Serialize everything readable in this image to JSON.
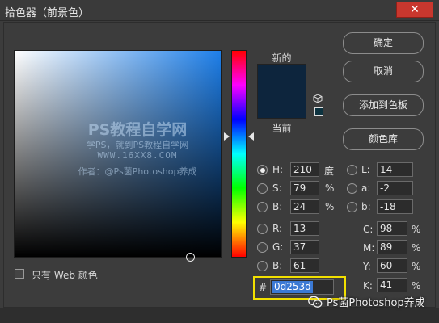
{
  "window": {
    "title": "拾色器（前景色）",
    "close_glyph": "✕"
  },
  "watermark": {
    "line1": "PS教程自学网",
    "line2": "学PS，就到PS教程自学网",
    "line3": "WWW.16XX8.COM",
    "line4": "作者：@Ps菌Photoshop养成"
  },
  "preview": {
    "new_label": "新的",
    "current_label": "当前",
    "current_color": "#0d253d",
    "new_color": "#0d253d"
  },
  "buttons": {
    "ok": "确定",
    "cancel": "取消",
    "add_to_swatches": "添加到色板",
    "color_libraries": "颜色库"
  },
  "hsb": {
    "h": {
      "label": "H:",
      "value": "210",
      "unit": "度"
    },
    "s": {
      "label": "S:",
      "value": "79",
      "unit": "%"
    },
    "b": {
      "label": "B:",
      "value": "24",
      "unit": "%"
    }
  },
  "rgb": {
    "r": {
      "label": "R:",
      "value": "13"
    },
    "g": {
      "label": "G:",
      "value": "37"
    },
    "b": {
      "label": "B:",
      "value": "61"
    }
  },
  "lab": {
    "l": {
      "label": "L:",
      "value": "14"
    },
    "a": {
      "label": "a:",
      "value": "-2"
    },
    "b": {
      "label": "b:",
      "value": "-18"
    }
  },
  "cmyk": {
    "c": {
      "label": "C:",
      "value": "98",
      "unit": "%"
    },
    "m": {
      "label": "M:",
      "value": "89",
      "unit": "%"
    },
    "y": {
      "label": "Y:",
      "value": "60",
      "unit": "%"
    },
    "k": {
      "label": "K:",
      "value": "41",
      "unit": "%"
    }
  },
  "hex": {
    "hash": "#",
    "value": "0d253d",
    "highlight_color": "#f2e000"
  },
  "web_only": {
    "label": "只有 Web 颜色",
    "checked": false
  },
  "brand": {
    "text": "Ps菌Photoshop养成"
  },
  "selected_mode": "H"
}
